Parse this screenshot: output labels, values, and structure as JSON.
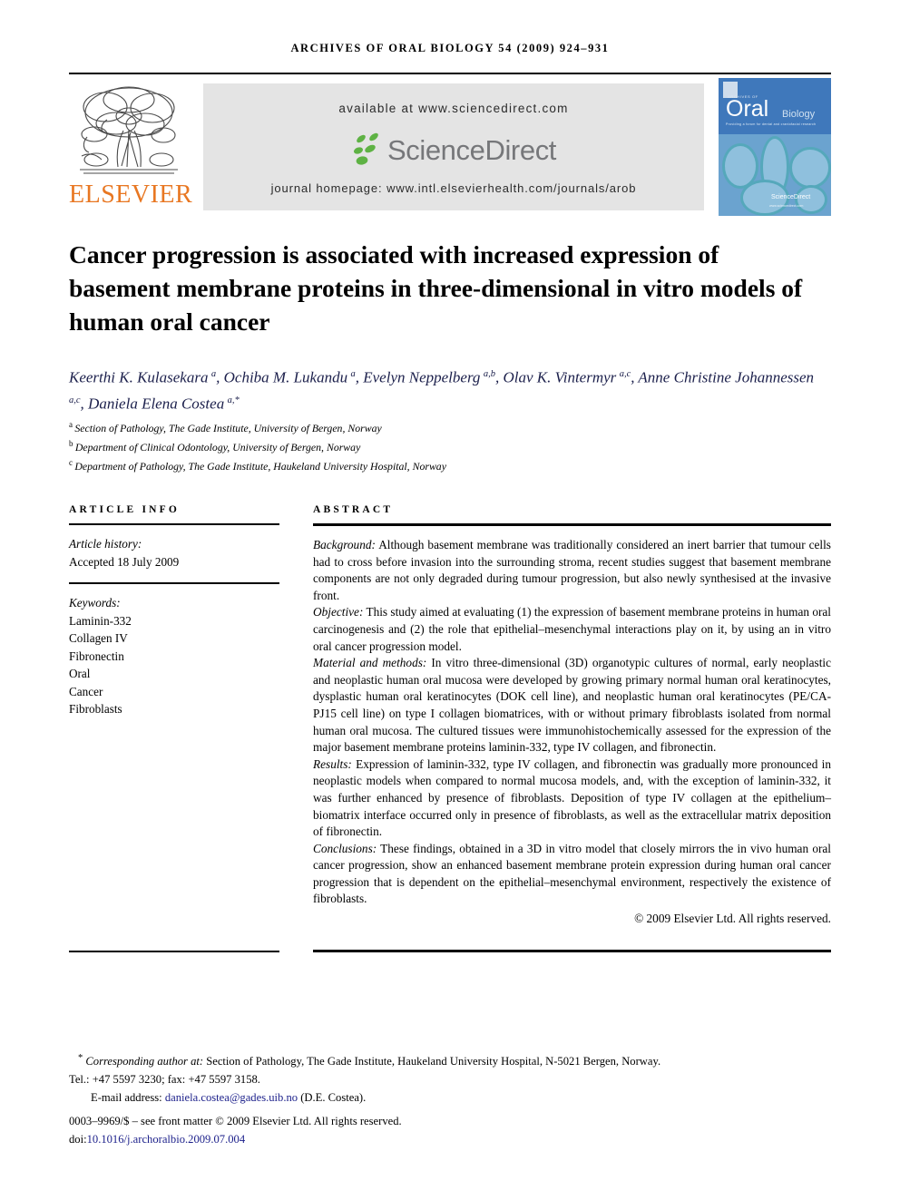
{
  "masthead": "ARCHIVES OF ORAL BIOLOGY 54 (2009) 924–931",
  "banner": {
    "publisher_logo": "ELSEVIER",
    "available_at": "available at www.sciencedirect.com",
    "sciencedirect_wordmark": "ScienceDirect",
    "journal_homepage": "journal homepage: www.intl.elsevierhealth.com/journals/arob",
    "cover": {
      "archives_of": "ARCHIVES OF",
      "oral": "Oral",
      "biology": "Biology",
      "tagline": "Providing a forum for dental and craniofacial research",
      "sciencedirect": "ScienceDirect",
      "sciencedirect_url": "www.sciencedirect.com",
      "color": "#4a86c5"
    }
  },
  "article": {
    "title": "Cancer progression is associated with increased expression of basement membrane proteins in three-dimensional in vitro models of human oral cancer",
    "authors": "Keerthi K. Kulasekara a, Ochiba M. Lukandu a, Evelyn Neppelberg a,b, Olav K. Vintermyr a,c, Anne Christine Johannessen a,c, Daniela Elena Costea a,*",
    "author_color": "#1b1f4b",
    "affiliations": [
      {
        "marker": "a",
        "text": "Section of Pathology, The Gade Institute, University of Bergen, Norway"
      },
      {
        "marker": "b",
        "text": "Department of Clinical Odontology, University of Bergen, Norway"
      },
      {
        "marker": "c",
        "text": "Department of Pathology, The Gade Institute, Haukeland University Hospital, Norway"
      }
    ]
  },
  "article_info": {
    "heading": "ARTICLE INFO",
    "history_label": "Article history:",
    "history_value": "Accepted 18 July 2009",
    "keywords_label": "Keywords:",
    "keywords": [
      "Laminin-332",
      "Collagen IV",
      "Fibronectin",
      "Oral",
      "Cancer",
      "Fibroblasts"
    ]
  },
  "abstract": {
    "heading": "ABSTRACT",
    "sections": [
      {
        "label": "Background:",
        "text": " Although basement membrane was traditionally considered an inert barrier that tumour cells had to cross before invasion into the surrounding stroma, recent studies suggest that basement membrane components are not only degraded during tumour progression, but also newly synthesised at the invasive front."
      },
      {
        "label": "Objective:",
        "text": " This study aimed at evaluating (1) the expression of basement membrane proteins in human oral carcinogenesis and (2) the role that epithelial–mesenchymal interactions play on it, by using an in vitro oral cancer progression model."
      },
      {
        "label": "Material and methods:",
        "text": " In vitro three-dimensional (3D) organotypic cultures of normal, early neoplastic and neoplastic human oral mucosa were developed by growing primary normal human oral keratinocytes, dysplastic human oral keratinocytes (DOK cell line), and neoplastic human oral keratinocytes (PE/CA-PJ15 cell line) on type I collagen biomatrices, with or without primary fibroblasts isolated from normal human oral mucosa. The cultured tissues were immunohistochemically assessed for the expression of the major basement membrane proteins laminin-332, type IV collagen, and fibronectin."
      },
      {
        "label": "Results:",
        "text": " Expression of laminin-332, type IV collagen, and fibronectin was gradually more pronounced in neoplastic models when compared to normal mucosa models, and, with the exception of laminin-332, it was further enhanced by presence of fibroblasts. Deposition of type IV collagen at the epithelium–biomatrix interface occurred only in presence of fibroblasts, as well as the extracellular matrix deposition of fibronectin."
      },
      {
        "label": "Conclusions:",
        "text": " These findings, obtained in a 3D in vitro model that closely mirrors the in vivo human oral cancer progression, show an enhanced basement membrane protein expression during human oral cancer progression that is dependent on the epithelial–mesenchymal environment, respectively the existence of fibroblasts."
      }
    ],
    "copyright": "© 2009 Elsevier Ltd. All rights reserved."
  },
  "footer": {
    "corresponding_marker": "*",
    "corresponding_lead": "Corresponding author at:",
    "corresponding_text": " Section of Pathology, The Gade Institute, Haukeland University Hospital, N-5021 Bergen, Norway.",
    "tel_line": "Tel.: +47 5597 3230; fax: +47 5597 3158.",
    "email_label": "E-mail address:",
    "email": "daniela.costea@gades.uib.no",
    "email_suffix": " (D.E. Costea).",
    "issn_line": "0003–9969/$ – see front matter © 2009 Elsevier Ltd. All rights reserved.",
    "doi_prefix": "doi:",
    "doi": "10.1016/j.archoralbio.2009.07.004",
    "link_color": "#1b1f8a"
  }
}
